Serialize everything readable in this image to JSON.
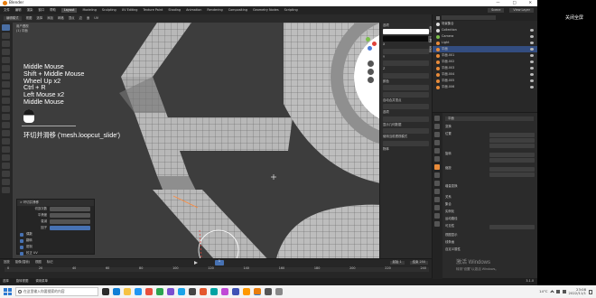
{
  "window": {
    "title": "Blender",
    "controls": [
      "—",
      "□",
      "✕"
    ]
  },
  "menus": [
    "文件",
    "编辑",
    "渲染",
    "窗口",
    "帮助"
  ],
  "workspace_tabs": [
    "Layout",
    "Modeling",
    "Sculpting",
    "UV Editing",
    "Texture Paint",
    "Shading",
    "Animation",
    "Rendering",
    "Compositing",
    "Geometry Nodes",
    "Scripting"
  ],
  "active_tab": "Layout",
  "scene_fields": [
    "Scene",
    "View Layer"
  ],
  "viewport": {
    "header_items": [
      "编辑模式",
      "视图",
      "选择",
      "添加",
      "网格",
      "顶点",
      "边",
      "面",
      "UV"
    ],
    "view_label": "用户透视",
    "object_label": "(1) 平面",
    "key_log": [
      "Middle Mouse",
      "Shift + Middle Mouse",
      "Wheel Up x2",
      "Ctrl + R",
      "Left Mouse x2",
      "Middle Mouse"
    ],
    "operator_caption": "环切并滑移 ('mesh.loopcut_slide')"
  },
  "last_operator_panel": {
    "title": "> 环切并滑移",
    "rows": [
      "切割次数",
      "平滑度",
      "衰减",
      "因子",
      "偶数",
      "翻转",
      "钳制",
      "校正 UV"
    ]
  },
  "npanel": {
    "tabs": [
      "条目",
      "工具",
      "视图"
    ],
    "sections": [
      "选项",
      "X",
      "Y",
      "Z",
      "颜色",
      "自动合并顶点",
      "选项",
      "显示几何数据",
      "使用当前透视模式",
      "物体"
    ]
  },
  "outliner": {
    "items": [
      {
        "name": "场景集合",
        "icon": "collection"
      },
      {
        "name": "Collection",
        "icon": "collection"
      },
      {
        "name": "Camera",
        "icon": "camera"
      },
      {
        "name": "Light",
        "icon": "light"
      },
      {
        "name": "平面",
        "icon": "mesh",
        "selected": true
      },
      {
        "name": "平面.001",
        "icon": "mesh"
      },
      {
        "name": "平面.002",
        "icon": "mesh"
      },
      {
        "name": "平面.003",
        "icon": "mesh"
      },
      {
        "name": "平面.004",
        "icon": "mesh"
      },
      {
        "name": "平面.005",
        "icon": "mesh"
      },
      {
        "name": "平面.006",
        "icon": "mesh"
      }
    ]
  },
  "properties": {
    "object_name": "平面",
    "sections": [
      "变换",
      "位置",
      "旋转",
      "缩放",
      "增量变换",
      "关系",
      "集合",
      "实例化",
      "运动路径",
      "可见性",
      "视图显示",
      "线条画",
      "自定义属性"
    ]
  },
  "timeline": {
    "items": [
      "回放",
      "抠像(插帧)",
      "视图",
      "标记"
    ],
    "frame": "1",
    "start": "起始 1",
    "end": "结束 250",
    "ticks": [
      "0",
      "20",
      "40",
      "60",
      "80",
      "100",
      "120",
      "140",
      "160",
      "180",
      "200",
      "220",
      "240"
    ]
  },
  "statusbar": [
    "选择",
    "旋转视图",
    "调用菜单",
    "3.1.0"
  ],
  "watermark": {
    "title": "激活 Windows",
    "subtitle": "转到\"设置\"以激活 Windows。"
  },
  "taskbar": {
    "search_placeholder": "在这里输入你要搜索的内容",
    "temperature": "14°C",
    "time": "23:08",
    "date": "2022/11/1"
  },
  "overlay_button": "关闭全屏",
  "colors": {
    "accent": "#4772b3",
    "viewport_bg": "#3d3d3d",
    "mesh_face": "#b8b8b8",
    "selected_edge": "#ffa733"
  }
}
